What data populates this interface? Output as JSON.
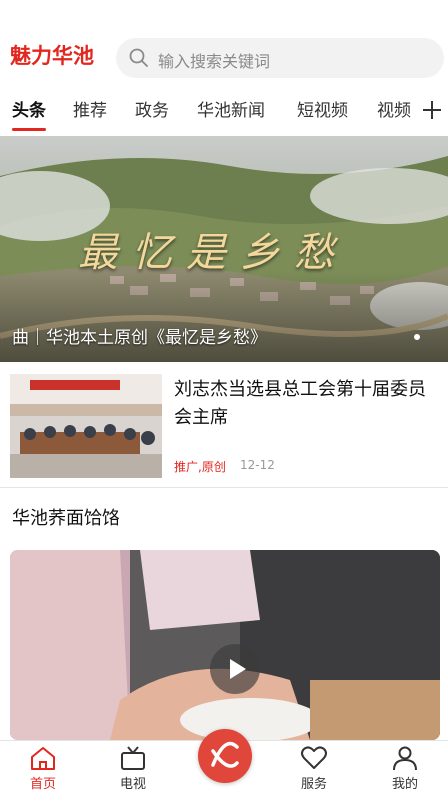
{
  "app": {
    "logo_text": "魅力华池"
  },
  "search": {
    "placeholder": "输入搜索关键词"
  },
  "tabs": [
    {
      "label": "头条",
      "active": true
    },
    {
      "label": "推荐"
    },
    {
      "label": "政务"
    },
    {
      "label": "华池新闻"
    },
    {
      "label": "短视频"
    },
    {
      "label": "视频"
    }
  ],
  "hero": {
    "title_art": "最忆是乡愁",
    "caption": "曲｜华池本土原创《最忆是乡愁》"
  },
  "news": [
    {
      "title": "刘志杰当选县总工会第十届委员会主席",
      "tag": "推广,原创",
      "date": "12-12"
    }
  ],
  "section": {
    "title": "华池荞面饸饹"
  },
  "bottom_nav": [
    {
      "label": "首页",
      "icon": "home-icon",
      "active": true
    },
    {
      "label": "电视",
      "icon": "tv-icon"
    },
    {
      "label": "",
      "icon": "center-logo-icon"
    },
    {
      "label": "服务",
      "icon": "heart-icon"
    },
    {
      "label": "我的",
      "icon": "user-icon"
    }
  ],
  "colors": {
    "accent": "#e2271f"
  }
}
